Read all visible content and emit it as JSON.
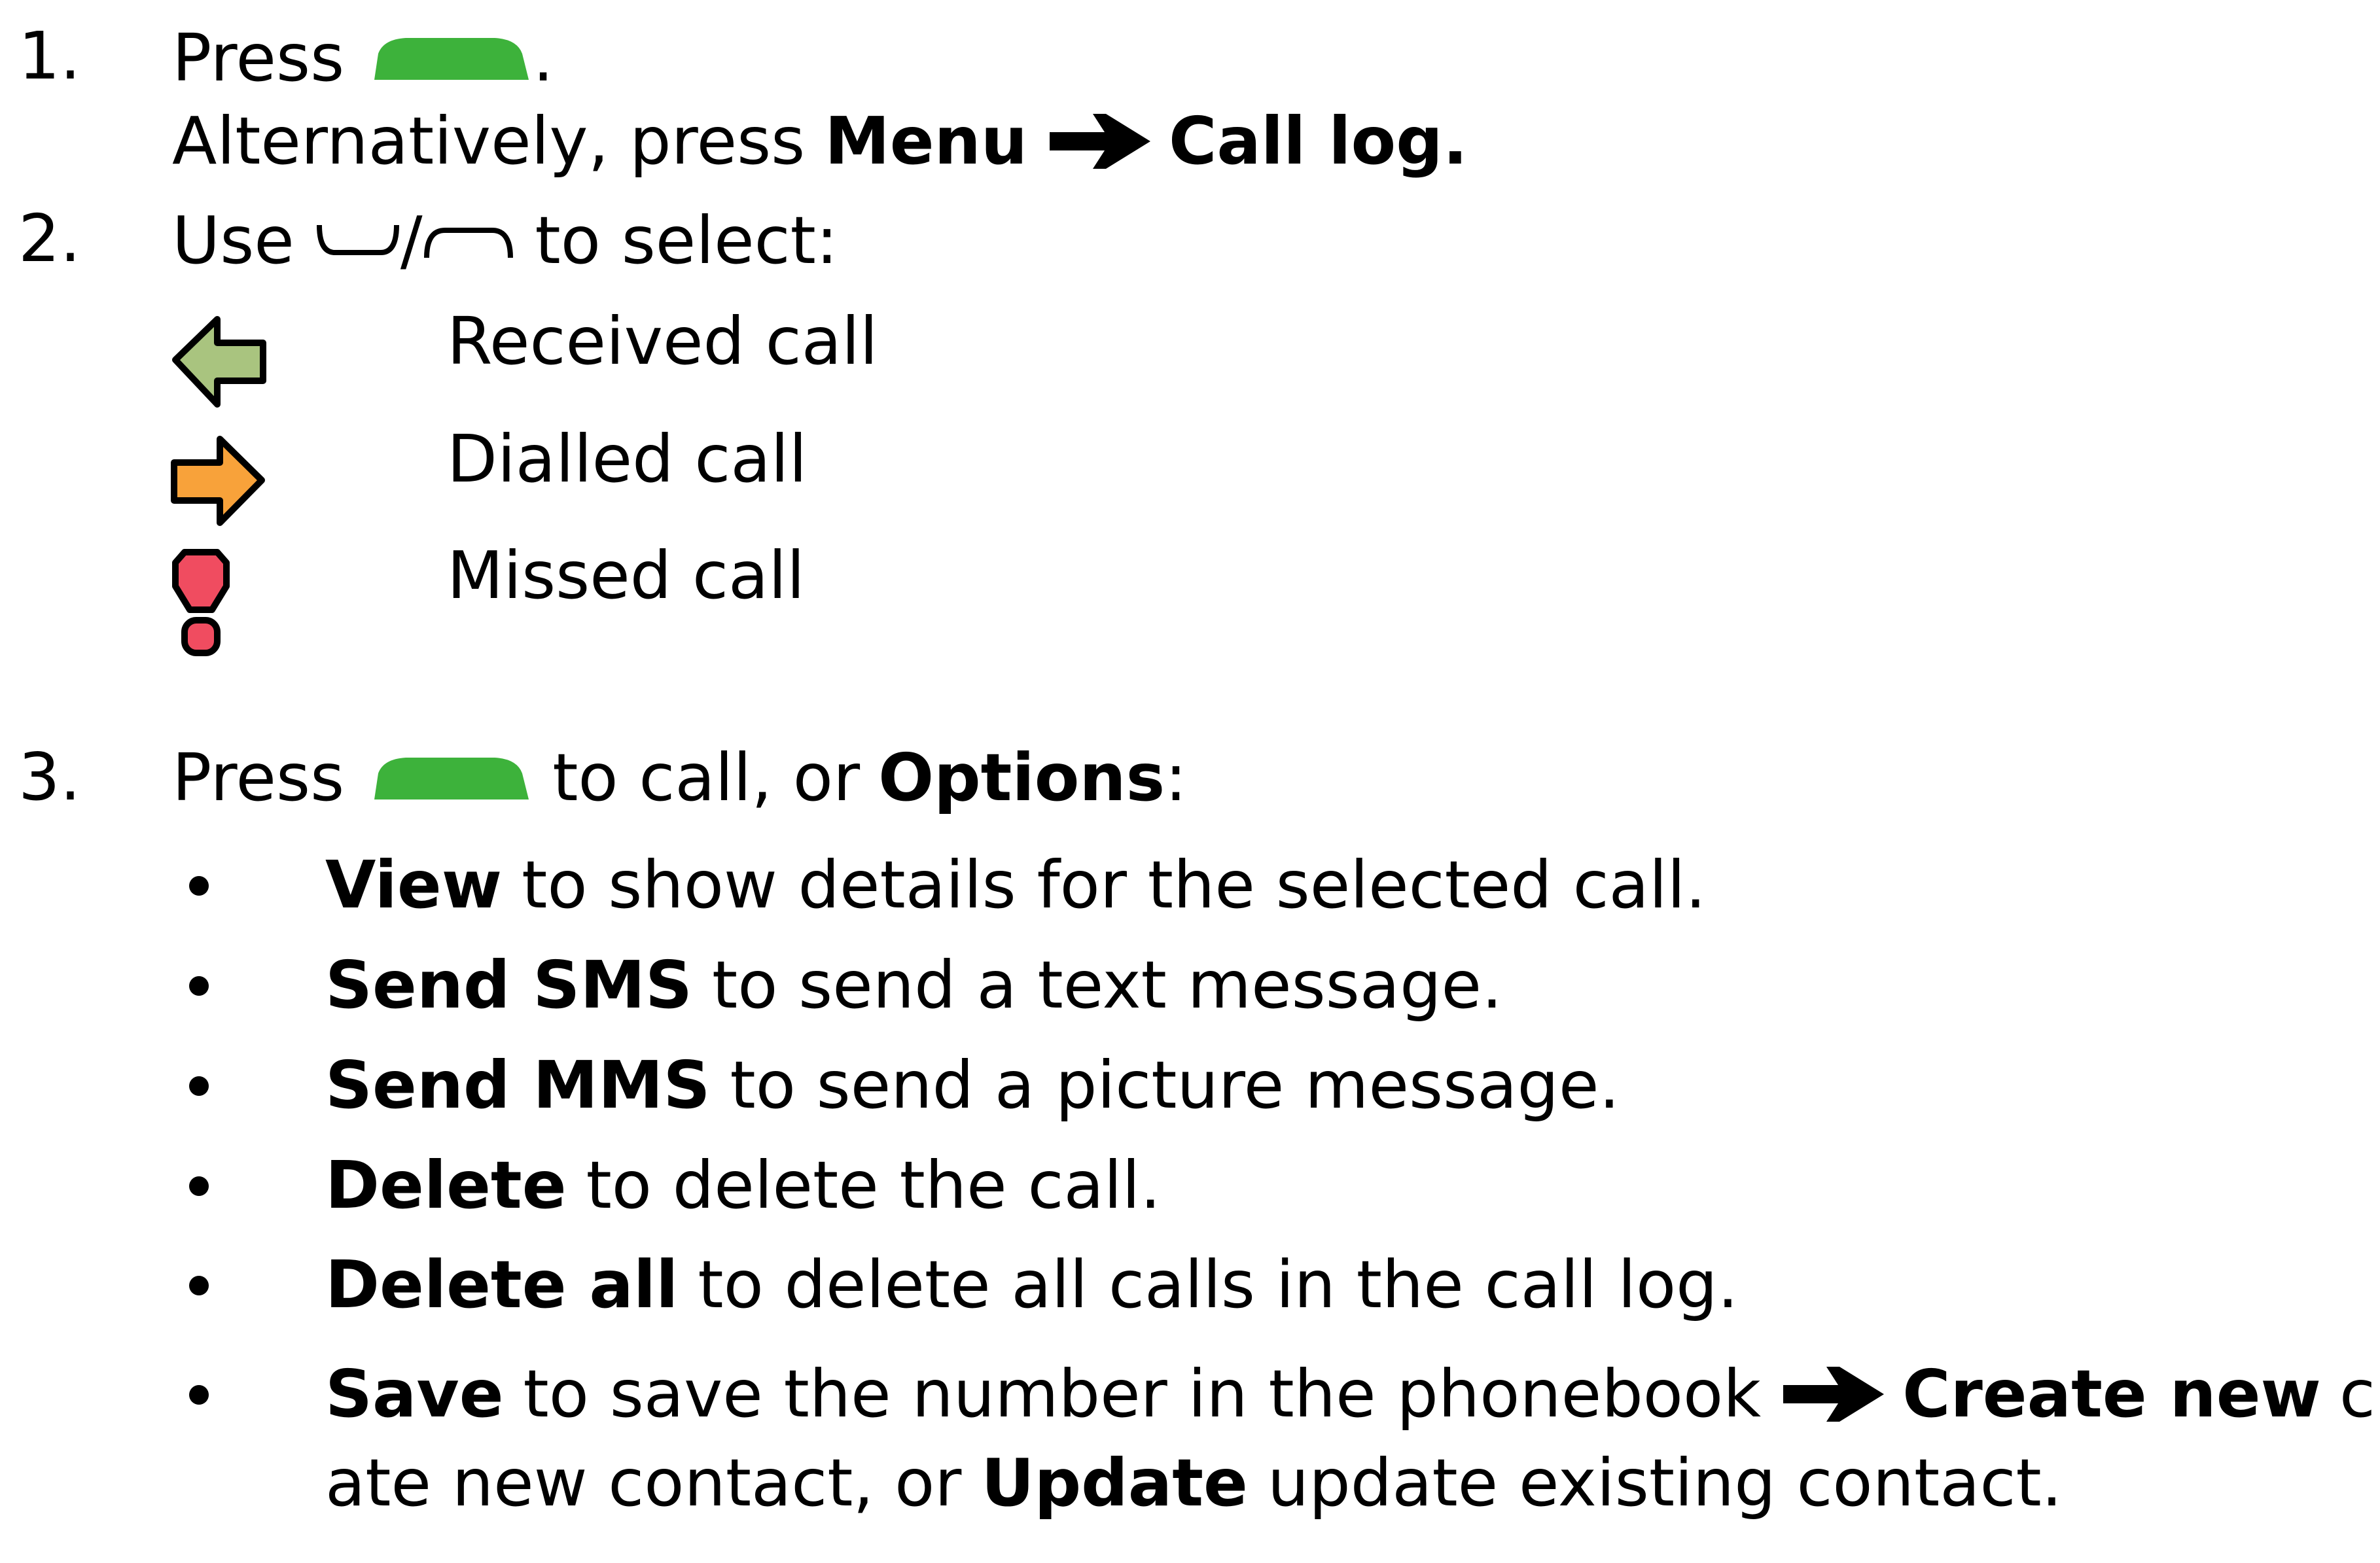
{
  "steps": [
    {
      "number": "1.",
      "line1_press": "Press",
      "line1_end": ".",
      "line2_prefix": "Alternatively, press",
      "line2_menu": "Menu",
      "line2_calllog": "Call log."
    },
    {
      "number": "2.",
      "use": "Use",
      "slash": "/",
      "to_select": "to select:",
      "legend": [
        {
          "icon": "received-call-icon",
          "label": "Received call",
          "color": "#a9c47f"
        },
        {
          "icon": "dialled-call-icon",
          "label": "Dialled call",
          "color": "#f8a23a"
        },
        {
          "icon": "missed-call-icon",
          "label": "Missed call",
          "color": "#f04c60"
        }
      ]
    },
    {
      "number": "3.",
      "press": "Press",
      "mid": "to call, or",
      "options": "Options",
      "colon": ":",
      "bullets": [
        {
          "bold": "View",
          "text": "to show details for the selected call."
        },
        {
          "bold": "Send SMS",
          "text": "to send a text message."
        },
        {
          "bold": "Send MMS",
          "text": "to send a picture message."
        },
        {
          "bold": "Delete",
          "text": "to delete the call."
        },
        {
          "bold": "Delete all",
          "text": "to delete all calls in the call log."
        }
      ],
      "save": {
        "bold": "Save",
        "text": "to save the number in the phonebook",
        "create_new": "Create new",
        "cre": "cre-",
        "ate": "ate new contact, or",
        "update": "Update",
        "tail": "update existing contact."
      }
    }
  ],
  "icons": {
    "call_key": "green-call-key-icon",
    "call_key_color": "#3db23b",
    "arrow": "right-arrow-icon",
    "nav_down": "nav-down-key-icon",
    "nav_up": "nav-up-key-icon"
  }
}
